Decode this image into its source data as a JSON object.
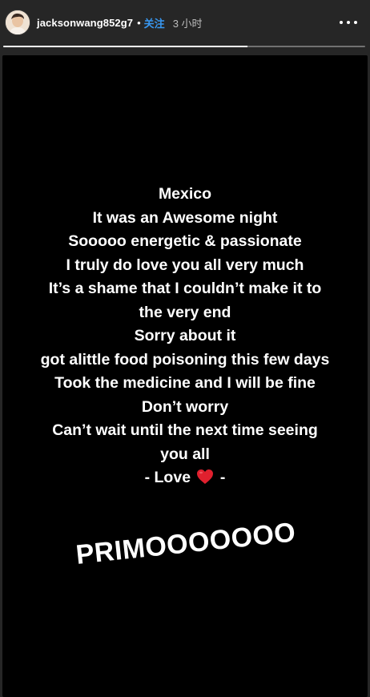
{
  "header": {
    "username": "jacksonwang852g7",
    "separator": "•",
    "follow_label": "关注",
    "timestamp": "3 小时"
  },
  "icons": {
    "avatar": "user-avatar",
    "more": "more-options-icon",
    "heart": "red-heart-emoji"
  },
  "progress": {
    "fraction": 0.675
  },
  "story": {
    "lines": [
      "Mexico",
      "It was an Awesome night",
      "Sooooo energetic & passionate",
      "I truly do love you all very much",
      "It’s a shame that I couldn’t make it to",
      "the very end",
      "Sorry about it",
      "got alittle food poisoning this few days",
      "Took the medicine and I will be fine",
      "Don’t worry",
      "Can’t wait until the next time seeing",
      "you all"
    ],
    "signoff_before": "- Love",
    "signoff_after": "-",
    "sticker_text": "PRIMOOOOOOO"
  },
  "colors": {
    "follow_blue": "#3897f0",
    "heart_red": "#e0202e",
    "story_bg": "#000000",
    "page_bg": "#262626"
  }
}
